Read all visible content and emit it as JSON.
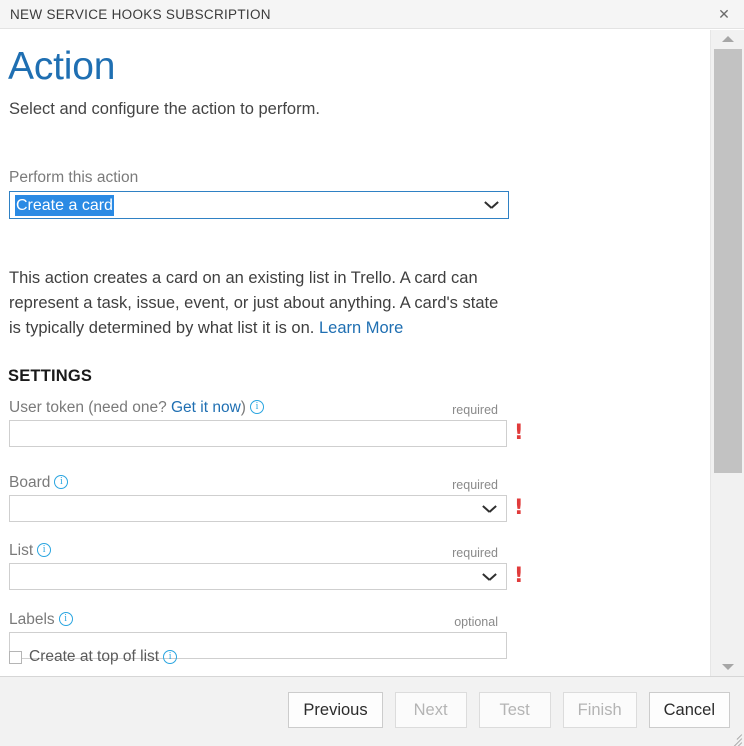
{
  "titlebar": {
    "title": "NEW SERVICE HOOKS SUBSCRIPTION",
    "close_icon": "close-icon",
    "close_glyph": "✕"
  },
  "page": {
    "title": "Action",
    "subtitle": "Select and configure the action to perform.",
    "title_color": "#1f6fb2"
  },
  "action_picker": {
    "label": "Perform this action",
    "selected_value": "Create a card",
    "selection_highlight_color": "#2a8ae4",
    "border_color": "#2f81c4",
    "chevron_icon": "chevron-down-icon"
  },
  "description": {
    "part1": "This action creates a card on an existing list in Trello. A card can represent a task, issue, event, or just about anything. A card's state is typically determined by what list it is on. ",
    "link": "Learn More",
    "link_color": "#1f6fb2"
  },
  "settings": {
    "heading": "SETTINGS",
    "fields": [
      {
        "label_prefix": "User token (need one? ",
        "label_link": "Get it now",
        "label_suffix": ")",
        "info_icon": "info-icon",
        "requirement": "required",
        "type": "text",
        "value": "",
        "error_icon": "error-exclamation-icon",
        "error_glyph": "!",
        "has_error": true
      },
      {
        "label_prefix": "Board",
        "label_link": "",
        "label_suffix": "",
        "info_icon": "info-icon",
        "requirement": "required",
        "type": "select",
        "value": "",
        "error_icon": "error-exclamation-icon",
        "error_glyph": "!",
        "has_error": true
      },
      {
        "label_prefix": "List",
        "label_link": "",
        "label_suffix": "",
        "info_icon": "info-icon",
        "requirement": "required",
        "type": "select",
        "value": "",
        "error_icon": "error-exclamation-icon",
        "error_glyph": "!",
        "has_error": true
      },
      {
        "label_prefix": "Labels",
        "label_link": "",
        "label_suffix": "",
        "info_icon": "info-icon",
        "requirement": "optional",
        "type": "text",
        "value": "",
        "error_icon": "",
        "error_glyph": "",
        "has_error": false
      }
    ],
    "checkbox": {
      "label": "Create at top of list",
      "checked": false,
      "info_icon": "info-icon"
    }
  },
  "scrollbar": {
    "up_icon": "scroll-up-arrow-icon",
    "down_icon": "scroll-down-arrow-icon"
  },
  "footer": {
    "buttons": [
      {
        "label": "Previous",
        "enabled": true
      },
      {
        "label": "Next",
        "enabled": false
      },
      {
        "label": "Test",
        "enabled": false
      },
      {
        "label": "Finish",
        "enabled": false
      },
      {
        "label": "Cancel",
        "enabled": true
      }
    ],
    "resize_grip_icon": "resize-grip-icon"
  },
  "colors": {
    "accent": "#1f6fb2",
    "selection": "#2a8ae4",
    "error": "#e03b3b",
    "info": "#2aa5e0",
    "footer_bg": "#f2f2f2",
    "titlebar_bg": "#f5f5f5"
  }
}
